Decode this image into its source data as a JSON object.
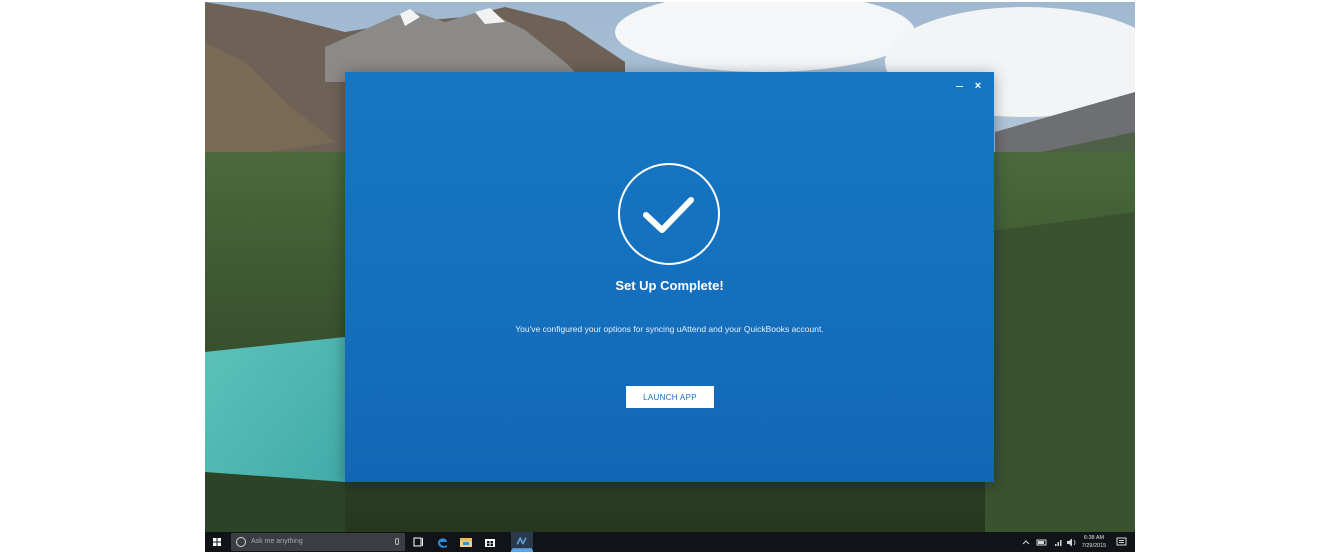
{
  "dialog": {
    "title": "Set Up Complete!",
    "message": "You've configured your options for syncing uAttend and your QuickBooks account.",
    "launch_label": "LAUNCH APP",
    "close_glyph": "×"
  },
  "taskbar": {
    "search_placeholder": "Ask me anything",
    "clock_time": "6:38 AM",
    "clock_date": "7/29/2015",
    "icons": [
      "windows-start-icon",
      "cortana-circle-icon",
      "microphone-icon",
      "task-view-icon",
      "edge-browser-icon",
      "file-explorer-icon",
      "store-icon",
      "uattend-app-icon"
    ]
  },
  "colors": {
    "dialog_blue": "#1577c4",
    "button_text": "#1a6fbf",
    "taskbar": "#101418"
  }
}
